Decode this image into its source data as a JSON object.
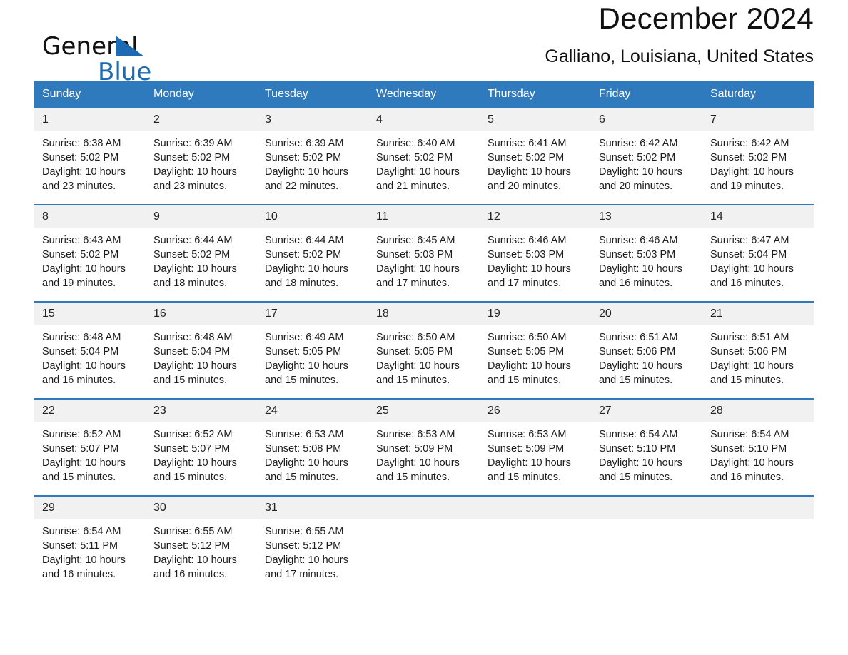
{
  "brand": {
    "name_part1": "General",
    "name_part2": "Blue",
    "triangle_color": "#1b6ab3",
    "accent_color": "#2f79bd"
  },
  "header": {
    "month_title": "December 2024",
    "location": "Galliano, Louisiana, United States"
  },
  "calendar": {
    "weekday_headers": [
      "Sunday",
      "Monday",
      "Tuesday",
      "Wednesday",
      "Thursday",
      "Friday",
      "Saturday"
    ],
    "labels": {
      "sunrise_prefix": "Sunrise:",
      "sunset_prefix": "Sunset:",
      "daylight_prefix": "Daylight:"
    },
    "weeks": [
      [
        {
          "day": "1",
          "sunrise": "Sunrise: 6:38 AM",
          "sunset": "Sunset: 5:02 PM",
          "daylight_line1": "Daylight: 10 hours",
          "daylight_line2": "and 23 minutes."
        },
        {
          "day": "2",
          "sunrise": "Sunrise: 6:39 AM",
          "sunset": "Sunset: 5:02 PM",
          "daylight_line1": "Daylight: 10 hours",
          "daylight_line2": "and 23 minutes."
        },
        {
          "day": "3",
          "sunrise": "Sunrise: 6:39 AM",
          "sunset": "Sunset: 5:02 PM",
          "daylight_line1": "Daylight: 10 hours",
          "daylight_line2": "and 22 minutes."
        },
        {
          "day": "4",
          "sunrise": "Sunrise: 6:40 AM",
          "sunset": "Sunset: 5:02 PM",
          "daylight_line1": "Daylight: 10 hours",
          "daylight_line2": "and 21 minutes."
        },
        {
          "day": "5",
          "sunrise": "Sunrise: 6:41 AM",
          "sunset": "Sunset: 5:02 PM",
          "daylight_line1": "Daylight: 10 hours",
          "daylight_line2": "and 20 minutes."
        },
        {
          "day": "6",
          "sunrise": "Sunrise: 6:42 AM",
          "sunset": "Sunset: 5:02 PM",
          "daylight_line1": "Daylight: 10 hours",
          "daylight_line2": "and 20 minutes."
        },
        {
          "day": "7",
          "sunrise": "Sunrise: 6:42 AM",
          "sunset": "Sunset: 5:02 PM",
          "daylight_line1": "Daylight: 10 hours",
          "daylight_line2": "and 19 minutes."
        }
      ],
      [
        {
          "day": "8",
          "sunrise": "Sunrise: 6:43 AM",
          "sunset": "Sunset: 5:02 PM",
          "daylight_line1": "Daylight: 10 hours",
          "daylight_line2": "and 19 minutes."
        },
        {
          "day": "9",
          "sunrise": "Sunrise: 6:44 AM",
          "sunset": "Sunset: 5:02 PM",
          "daylight_line1": "Daylight: 10 hours",
          "daylight_line2": "and 18 minutes."
        },
        {
          "day": "10",
          "sunrise": "Sunrise: 6:44 AM",
          "sunset": "Sunset: 5:02 PM",
          "daylight_line1": "Daylight: 10 hours",
          "daylight_line2": "and 18 minutes."
        },
        {
          "day": "11",
          "sunrise": "Sunrise: 6:45 AM",
          "sunset": "Sunset: 5:03 PM",
          "daylight_line1": "Daylight: 10 hours",
          "daylight_line2": "and 17 minutes."
        },
        {
          "day": "12",
          "sunrise": "Sunrise: 6:46 AM",
          "sunset": "Sunset: 5:03 PM",
          "daylight_line1": "Daylight: 10 hours",
          "daylight_line2": "and 17 minutes."
        },
        {
          "day": "13",
          "sunrise": "Sunrise: 6:46 AM",
          "sunset": "Sunset: 5:03 PM",
          "daylight_line1": "Daylight: 10 hours",
          "daylight_line2": "and 16 minutes."
        },
        {
          "day": "14",
          "sunrise": "Sunrise: 6:47 AM",
          "sunset": "Sunset: 5:04 PM",
          "daylight_line1": "Daylight: 10 hours",
          "daylight_line2": "and 16 minutes."
        }
      ],
      [
        {
          "day": "15",
          "sunrise": "Sunrise: 6:48 AM",
          "sunset": "Sunset: 5:04 PM",
          "daylight_line1": "Daylight: 10 hours",
          "daylight_line2": "and 16 minutes."
        },
        {
          "day": "16",
          "sunrise": "Sunrise: 6:48 AM",
          "sunset": "Sunset: 5:04 PM",
          "daylight_line1": "Daylight: 10 hours",
          "daylight_line2": "and 15 minutes."
        },
        {
          "day": "17",
          "sunrise": "Sunrise: 6:49 AM",
          "sunset": "Sunset: 5:05 PM",
          "daylight_line1": "Daylight: 10 hours",
          "daylight_line2": "and 15 minutes."
        },
        {
          "day": "18",
          "sunrise": "Sunrise: 6:50 AM",
          "sunset": "Sunset: 5:05 PM",
          "daylight_line1": "Daylight: 10 hours",
          "daylight_line2": "and 15 minutes."
        },
        {
          "day": "19",
          "sunrise": "Sunrise: 6:50 AM",
          "sunset": "Sunset: 5:05 PM",
          "daylight_line1": "Daylight: 10 hours",
          "daylight_line2": "and 15 minutes."
        },
        {
          "day": "20",
          "sunrise": "Sunrise: 6:51 AM",
          "sunset": "Sunset: 5:06 PM",
          "daylight_line1": "Daylight: 10 hours",
          "daylight_line2": "and 15 minutes."
        },
        {
          "day": "21",
          "sunrise": "Sunrise: 6:51 AM",
          "sunset": "Sunset: 5:06 PM",
          "daylight_line1": "Daylight: 10 hours",
          "daylight_line2": "and 15 minutes."
        }
      ],
      [
        {
          "day": "22",
          "sunrise": "Sunrise: 6:52 AM",
          "sunset": "Sunset: 5:07 PM",
          "daylight_line1": "Daylight: 10 hours",
          "daylight_line2": "and 15 minutes."
        },
        {
          "day": "23",
          "sunrise": "Sunrise: 6:52 AM",
          "sunset": "Sunset: 5:07 PM",
          "daylight_line1": "Daylight: 10 hours",
          "daylight_line2": "and 15 minutes."
        },
        {
          "day": "24",
          "sunrise": "Sunrise: 6:53 AM",
          "sunset": "Sunset: 5:08 PM",
          "daylight_line1": "Daylight: 10 hours",
          "daylight_line2": "and 15 minutes."
        },
        {
          "day": "25",
          "sunrise": "Sunrise: 6:53 AM",
          "sunset": "Sunset: 5:09 PM",
          "daylight_line1": "Daylight: 10 hours",
          "daylight_line2": "and 15 minutes."
        },
        {
          "day": "26",
          "sunrise": "Sunrise: 6:53 AM",
          "sunset": "Sunset: 5:09 PM",
          "daylight_line1": "Daylight: 10 hours",
          "daylight_line2": "and 15 minutes."
        },
        {
          "day": "27",
          "sunrise": "Sunrise: 6:54 AM",
          "sunset": "Sunset: 5:10 PM",
          "daylight_line1": "Daylight: 10 hours",
          "daylight_line2": "and 15 minutes."
        },
        {
          "day": "28",
          "sunrise": "Sunrise: 6:54 AM",
          "sunset": "Sunset: 5:10 PM",
          "daylight_line1": "Daylight: 10 hours",
          "daylight_line2": "and 16 minutes."
        }
      ],
      [
        {
          "day": "29",
          "sunrise": "Sunrise: 6:54 AM",
          "sunset": "Sunset: 5:11 PM",
          "daylight_line1": "Daylight: 10 hours",
          "daylight_line2": "and 16 minutes."
        },
        {
          "day": "30",
          "sunrise": "Sunrise: 6:55 AM",
          "sunset": "Sunset: 5:12 PM",
          "daylight_line1": "Daylight: 10 hours",
          "daylight_line2": "and 16 minutes."
        },
        {
          "day": "31",
          "sunrise": "Sunrise: 6:55 AM",
          "sunset": "Sunset: 5:12 PM",
          "daylight_line1": "Daylight: 10 hours",
          "daylight_line2": "and 17 minutes."
        },
        {
          "day": "",
          "sunrise": "",
          "sunset": "",
          "daylight_line1": "",
          "daylight_line2": ""
        },
        {
          "day": "",
          "sunrise": "",
          "sunset": "",
          "daylight_line1": "",
          "daylight_line2": ""
        },
        {
          "day": "",
          "sunrise": "",
          "sunset": "",
          "daylight_line1": "",
          "daylight_line2": ""
        },
        {
          "day": "",
          "sunrise": "",
          "sunset": "",
          "daylight_line1": "",
          "daylight_line2": ""
        }
      ]
    ]
  }
}
